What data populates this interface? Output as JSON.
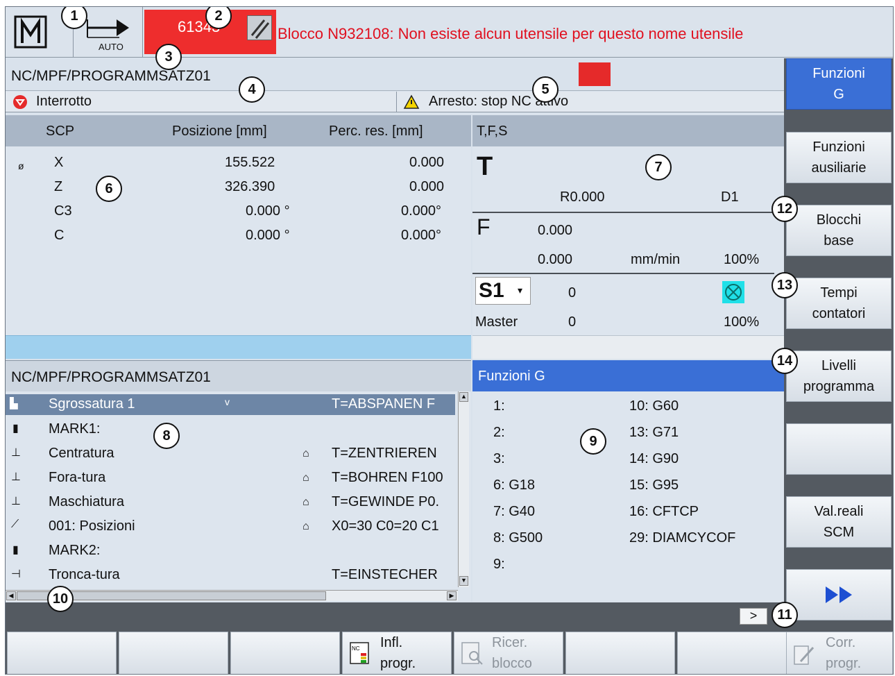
{
  "header": {
    "mode_label": "AUTO",
    "alarm_number": "61343",
    "alarm_message": "Blocco N932108: Non esiste alcun utensile per questo nome utensile"
  },
  "program_path": "NC/MPF/PROGRAMMSATZ01",
  "status": {
    "channel_state": "Interrotto",
    "stop_message": "Arresto: stop NC attivo"
  },
  "position": {
    "headers": [
      "SCP",
      "Posizione [mm]",
      "Perc. res. [mm]"
    ],
    "rows": [
      {
        "axis": "X",
        "pos": "155.522",
        "rem": "0.000"
      },
      {
        "axis": "Z",
        "pos": "326.390",
        "rem": "0.000"
      },
      {
        "axis": "C3",
        "pos": "0.000 °",
        "rem": "0.000°"
      },
      {
        "axis": "C",
        "pos": "0.000 °",
        "rem": "0.000°"
      }
    ],
    "diam_symbol": "ø"
  },
  "tfs": {
    "title": "T,F,S",
    "t_label": "T",
    "t_radius": "R0.000",
    "t_dnum": "D1",
    "f_label": "F",
    "f_value1": "0.000",
    "f_value2": "0.000",
    "f_unit": "mm/min",
    "f_override": "100%",
    "s_label": "S1",
    "s_value": "0",
    "s_mode": "Master",
    "s_value2": "0",
    "s_override": "100%"
  },
  "program": {
    "title": "NC/MPF/PROGRAMMSATZ01",
    "rows": [
      {
        "name": "Sgrossatura 1",
        "extra": "v",
        "param": "T=ABSPANEN F"
      },
      {
        "name": "MARK1:",
        "param": ""
      },
      {
        "name": "Centratura",
        "param": "T=ZENTRIEREN"
      },
      {
        "name": "Fora-tura",
        "param": "T=BOHREN F100"
      },
      {
        "name": "Maschiatura",
        "param": "T=GEWINDE P0."
      },
      {
        "name": "001: Posizioni",
        "param": "X0=30 C0=20 C1"
      },
      {
        "name": "MARK2:",
        "param": ""
      },
      {
        "name": "Tronca-tura",
        "param": "T=EINSTECHER"
      }
    ]
  },
  "gfunctions": {
    "title": "Funzioni G",
    "col1": [
      "1:",
      "2:",
      "3:",
      "6: G18",
      "7: G40",
      "8: G500",
      "9:"
    ],
    "col2": [
      "10: G60",
      "13: G71",
      "14: G90",
      "15: G95",
      "16: CFTCP",
      "29: DIAMCYCOF"
    ]
  },
  "vertical_softkeys": [
    {
      "l1": "Funzioni",
      "l2": "G",
      "active": true
    },
    {
      "l1": "Funzioni",
      "l2": "ausiliarie"
    },
    {
      "l1": "Blocchi",
      "l2": "base"
    },
    {
      "l1": "Tempi",
      "l2": "contatori"
    },
    {
      "l1": "Livelli",
      "l2": "programma"
    },
    {
      "l1": "",
      "l2": ""
    },
    {
      "l1": "Val.reali",
      "l2": "SCM"
    }
  ],
  "horizontal_softkeys": [
    {
      "l1": "Infl.",
      "l2": "progr."
    },
    {
      "l1": "Ricer.",
      "l2": "blocco"
    },
    {
      "l1": "Corr.",
      "l2": "progr."
    }
  ],
  "more_label": ">",
  "callouts": [
    "1",
    "2",
    "3",
    "4",
    "5",
    "6",
    "7",
    "8",
    "9",
    "10",
    "11",
    "12",
    "13",
    "14"
  ],
  "colors": {
    "accent": "#3a6fd6",
    "alarm": "#ee2d2d",
    "selection": "#6d86a6"
  }
}
